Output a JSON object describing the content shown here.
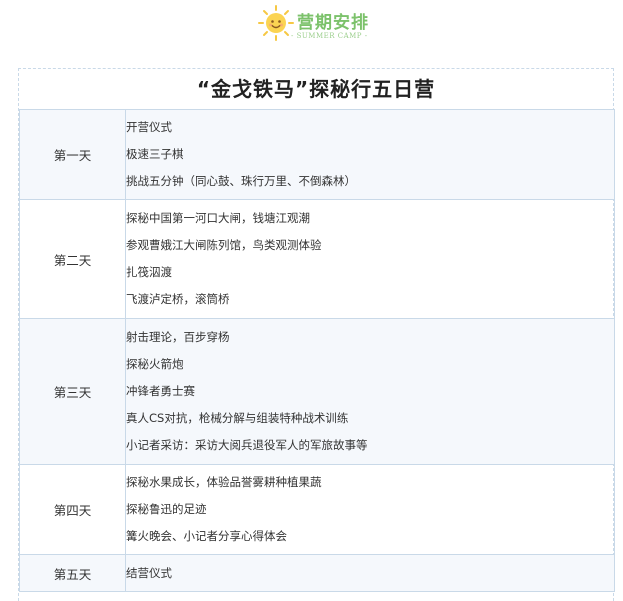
{
  "header": {
    "title": "营期安排",
    "subtitle": "- SUMMER CAMP -",
    "icon": "sun-icon"
  },
  "card": {
    "title": "“金戈铁马”探秘行五日营"
  },
  "days": [
    {
      "label": "第一天",
      "activities": [
        "开营仪式",
        "极速三子棋",
        "挑战五分钟（同心鼓、珠行万里、不倒森林）"
      ]
    },
    {
      "label": "第二天",
      "activities": [
        "探秘中国第一河口大闸，钱塘江观潮",
        "参观曹娥江大闸陈列馆，鸟类观测体验",
        "扎筏泅渡",
        "飞渡泸定桥，滚筒桥"
      ]
    },
    {
      "label": "第三天",
      "activities": [
        "射击理论，百步穿杨",
        "探秘火箭炮",
        "冲锋者勇士赛",
        "真人CS对抗，枪械分解与组装特种战术训练",
        "小记者采访：采访大阅兵退役军人的军旅故事等"
      ]
    },
    {
      "label": "第四天",
      "activities": [
        "探秘水果成长，体验品誉雾耕种植果蔬",
        "探秘鲁迅的足迹",
        "篝火晚会、小记者分享心得体会"
      ]
    },
    {
      "label": "第五天",
      "activities": [
        "结营仪式"
      ]
    }
  ],
  "colors": {
    "accent": "#7cc26b",
    "border": "#c9d9e8",
    "row_shade": "#f5f8fc"
  }
}
